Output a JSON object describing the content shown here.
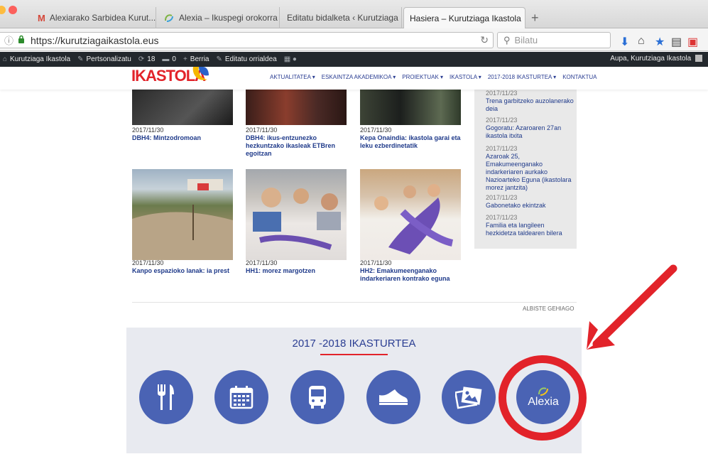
{
  "browser": {
    "tabs": [
      {
        "title": "Alexiarako Sarbidea Kurut...",
        "favicon": "gmail-icon"
      },
      {
        "title": "Alexia – Ikuspegi orokorra",
        "favicon": "alexia-icon"
      },
      {
        "title": "Editatu bidalketa ‹ Kurutziaga ...",
        "favicon": "none"
      },
      {
        "title": "Hasiera – Kurutziaga Ikastola",
        "favicon": "none"
      }
    ],
    "tab_close": "×",
    "new_tab": "+",
    "url": "https://kurutziagaikastola.eus",
    "search_placeholder": "Bilatu"
  },
  "adminbar": {
    "site": "Kurutziaga Ikastola",
    "customize": "Pertsonalizatu",
    "updates": "18",
    "comments": "0",
    "new": "Berria",
    "edit": "Editatu orrialdea",
    "greeting": "Aupa, Kurutziaga Ikastola"
  },
  "header": {
    "logo_text": "IKASTOLA",
    "nav": [
      "AKTUALITATEA ▾",
      "ESKAINTZA AKADEMIKOA ▾",
      "PROIEKTUAK ▾",
      "IKASTOLA ▾",
      "2017-2018 IKASTURTEA ▾",
      "KONTAKTUA"
    ]
  },
  "news": [
    {
      "date": "2017/11/30",
      "title": "DBH4: Mintzodromoan"
    },
    {
      "date": "2017/11/30",
      "title": "DBH4: ikus-entzunezko hezkuntzako ikasleak ETBren egoitzan"
    },
    {
      "date": "2017/11/30",
      "title": "Kepa Onaindia: ikastola garai eta leku ezberdinetatik"
    },
    {
      "date": "2017/11/30",
      "title": "Kanpo espazioko lanak: ia prest"
    },
    {
      "date": "2017/11/30",
      "title": "HH1: morez margotzen"
    },
    {
      "date": "2017/11/30",
      "title": "HH2: Emakumeenganako indarkeriaren kontrako eguna"
    }
  ],
  "sidebar": [
    {
      "date": "2017/11/23",
      "title": "Trena garbitzeko auzolanerako deia"
    },
    {
      "date": "2017/11/23",
      "title": "Gogoratu: Azaroaren 27an ikastola itxita"
    },
    {
      "date": "2017/11/23",
      "title": "Azaroak 25, Emakumeenganako indarkeriaren aurkako Nazioarteko Eguna (ikastolara morez jantzita)"
    },
    {
      "date": "2017/11/23",
      "title": "Gabonetako ekintzak"
    },
    {
      "date": "2017/11/23",
      "title": "Familia eta langileen hezkidetza taldearen bilera"
    }
  ],
  "more_news": "ALBISTE GEHIAGO",
  "section": {
    "title": "2017 -2018 IKASTURTEA",
    "icons": [
      "fork-knife-icon",
      "calendar-icon",
      "bus-icon",
      "shoe-icon",
      "photos-icon",
      "alexia-logo"
    ],
    "alexia_label": "Alexia"
  },
  "colors": {
    "brand_blue": "#4a63b4",
    "nav_blue": "#2a3d92",
    "accent_red": "#e2232a",
    "admin_bg": "#23282d"
  }
}
